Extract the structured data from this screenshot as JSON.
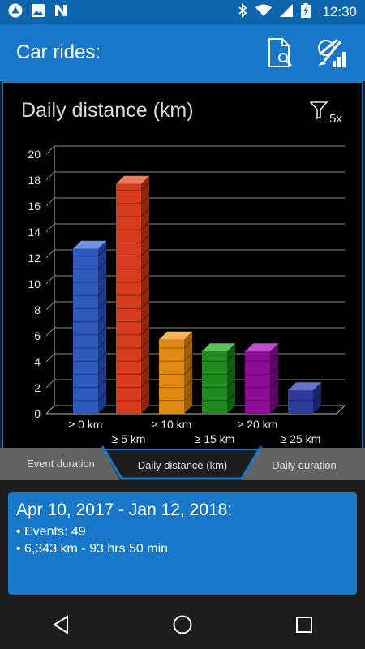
{
  "status_bar": {
    "time": "12:30"
  },
  "app_bar": {
    "title": "Car rides:"
  },
  "chart_data": {
    "type": "bar",
    "title": "Daily distance (km)",
    "filter_count": "5x",
    "categories": [
      "≥ 0 km",
      "≥ 5 km",
      "≥ 10 km",
      "≥ 15 km",
      "≥ 20 km",
      "≥ 25 km"
    ],
    "values": [
      12.7,
      17.7,
      5.7,
      4.8,
      4.8,
      1.8
    ],
    "ylim": [
      0,
      20
    ],
    "yticks": [
      0,
      2,
      4,
      6,
      8,
      10,
      12,
      14,
      16,
      18,
      20
    ],
    "grid": true,
    "colors": [
      {
        "front": "#2e59bd",
        "side": "#1d3a85",
        "top": "#6f92e8"
      },
      {
        "front": "#d63b1c",
        "side": "#8f2410",
        "top": "#f27a5c"
      },
      {
        "front": "#e08a12",
        "side": "#9c5d08",
        "top": "#f7b557"
      },
      {
        "front": "#208a20",
        "side": "#125c12",
        "top": "#5ac45a"
      },
      {
        "front": "#8b0d96",
        "side": "#5c0863",
        "top": "#c24bcc"
      },
      {
        "front": "#2d3a9a",
        "side": "#1b2466",
        "top": "#6673cc"
      }
    ]
  },
  "tabs": [
    {
      "label": "Event duration",
      "active": false
    },
    {
      "label": "Daily distance (km)",
      "active": true
    },
    {
      "label": "Daily duration",
      "active": false
    }
  ],
  "summary": {
    "heading": "Apr 10, 2017 - Jan 12, 2018:",
    "lines": [
      "• Events: 49",
      "• 6,343 km - 93 hrs 50 min"
    ]
  },
  "colors": {
    "accent": "#1778c9",
    "status_bar": "#0d66ad",
    "background": "#1d1d1d"
  }
}
